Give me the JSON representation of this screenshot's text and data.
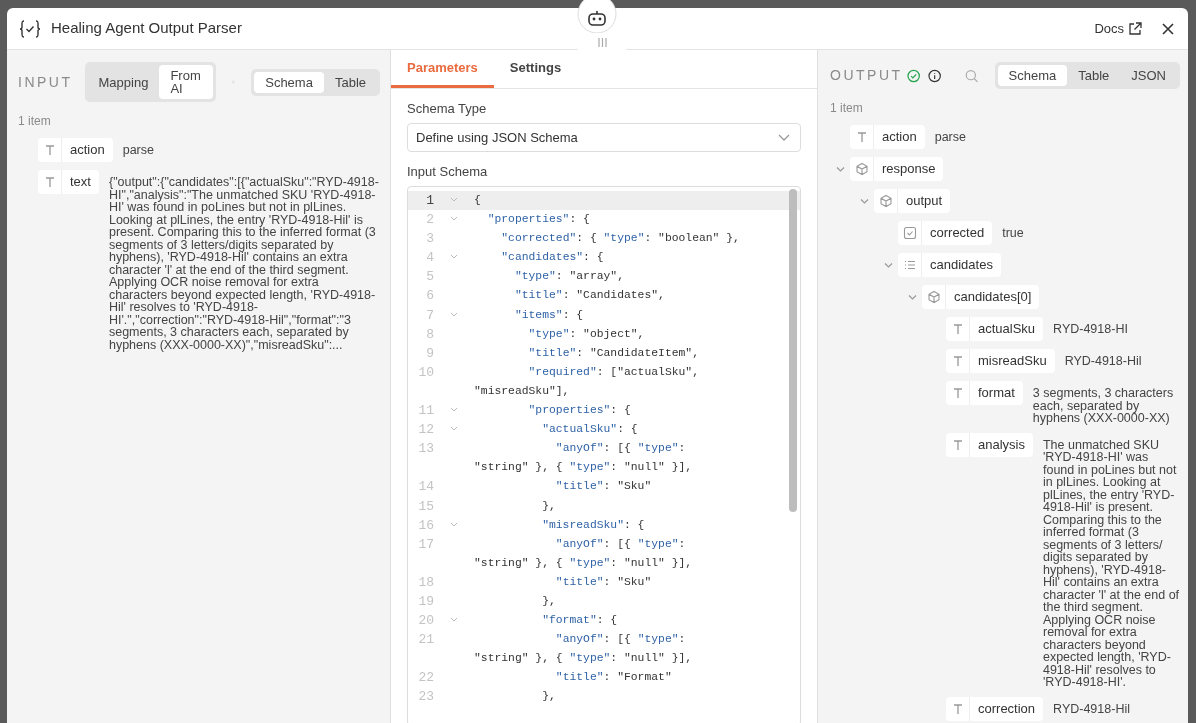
{
  "window": {
    "title": "Healing Agent Output Parser",
    "docs_link": "Docs"
  },
  "input": {
    "label": "INPUT",
    "count": "1 item",
    "mode_toggle": [
      {
        "label": "Mapping",
        "selected": false
      },
      {
        "label": "From AI",
        "selected": true
      }
    ],
    "view_toggle": [
      {
        "label": "Schema",
        "selected": true
      },
      {
        "label": "Table",
        "selected": false
      }
    ],
    "fields": [
      {
        "kind": "string",
        "key": "action",
        "value": "parse"
      },
      {
        "kind": "string",
        "key": "text",
        "value": "{\"output\":{\"candidates\":[{\"actualSku\":\"RYD-4918-HI\",\"analysis\":\"The unmatched SKU 'RYD-4918-HI' was found in poLines but not in plLines. Looking at plLines, the entry 'RYD-4918-Hil' is present. Comparing this to the inferred format (3 segments of 3 letters/digits separated by hyphens), 'RYD-4918-Hil' contains an extra character 'l' at the end of the third segment. Applying OCR noise removal for extra characters beyond expected length, 'RYD-4918-Hil' resolves to 'RYD-4918-HI'.\",\"correction\":\"RYD-4918-Hil\",\"format\":\"3 segments, 3 characters each, separated by hyphens (XXX-0000-XX)\",\"misreadSku\":..."
      }
    ]
  },
  "parameters": {
    "tabs": [
      {
        "label": "Parameters",
        "selected": true
      },
      {
        "label": "Settings",
        "selected": false
      }
    ],
    "schema_type": {
      "label": "Schema Type",
      "value": "Define using JSON Schema"
    },
    "input_schema": {
      "label": "Input Schema",
      "lines": [
        {
          "number": "1",
          "code": "{",
          "foldable": true,
          "active": true
        },
        {
          "number": "2",
          "code": "  \"properties\": {",
          "foldable": true,
          "active": false
        },
        {
          "number": "3",
          "code": "    \"corrected\": { \"type\": \"boolean\" },",
          "foldable": false,
          "active": false
        },
        {
          "number": "4",
          "code": "    \"candidates\": {",
          "foldable": true,
          "active": false
        },
        {
          "number": "5",
          "code": "      \"type\": \"array\",",
          "foldable": false,
          "active": false
        },
        {
          "number": "6",
          "code": "      \"title\": \"Candidates\",",
          "foldable": false,
          "active": false
        },
        {
          "number": "7",
          "code": "      \"items\": {",
          "foldable": true,
          "active": false
        },
        {
          "number": "8",
          "code": "        \"type\": \"object\",",
          "foldable": false,
          "active": false
        },
        {
          "number": "9",
          "code": "        \"title\": \"CandidateItem\",",
          "foldable": false,
          "active": false
        },
        {
          "number": "10",
          "code": "        \"required\": [\"actualSku\", \"misreadSku\"],",
          "foldable": false,
          "active": false
        },
        {
          "number": "11",
          "code": "        \"properties\": {",
          "foldable": true,
          "active": false
        },
        {
          "number": "12",
          "code": "          \"actualSku\": {",
          "foldable": true,
          "active": false
        },
        {
          "number": "13",
          "code": "            \"anyOf\": [{ \"type\": \"string\" }, { \"type\": \"null\" }],",
          "foldable": false,
          "active": false
        },
        {
          "number": "14",
          "code": "            \"title\": \"Sku\"",
          "foldable": false,
          "active": false
        },
        {
          "number": "15",
          "code": "          },",
          "foldable": false,
          "active": false
        },
        {
          "number": "16",
          "code": "          \"misreadSku\": {",
          "foldable": true,
          "active": false
        },
        {
          "number": "17",
          "code": "            \"anyOf\": [{ \"type\": \"string\" }, { \"type\": \"null\" }],",
          "foldable": false,
          "active": false
        },
        {
          "number": "18",
          "code": "            \"title\": \"Sku\"",
          "foldable": false,
          "active": false
        },
        {
          "number": "19",
          "code": "          },",
          "foldable": false,
          "active": false
        },
        {
          "number": "20",
          "code": "          \"format\": {",
          "foldable": true,
          "active": false
        },
        {
          "number": "21",
          "code": "            \"anyOf\": [{ \"type\": \"string\" }, { \"type\": \"null\" }],",
          "foldable": false,
          "active": false
        },
        {
          "number": "22",
          "code": "            \"title\": \"Format\"",
          "foldable": false,
          "active": false
        },
        {
          "number": "23",
          "code": "          },",
          "foldable": false,
          "active": false
        }
      ]
    }
  },
  "output": {
    "label": "OUTPUT",
    "count": "1 item",
    "view_toggle": [
      {
        "label": "Schema",
        "selected": true
      },
      {
        "label": "Table",
        "selected": false
      },
      {
        "label": "JSON",
        "selected": false
      }
    ],
    "fields": [
      {
        "kind": "string",
        "key": "action",
        "value": "parse"
      },
      {
        "kind": "object",
        "key": "response",
        "expanded": true,
        "children": [
          {
            "kind": "object",
            "key": "output",
            "expanded": true,
            "children": [
              {
                "kind": "boolean",
                "key": "corrected",
                "value": "true"
              },
              {
                "kind": "array",
                "key": "candidates",
                "expanded": true,
                "children": [
                  {
                    "kind": "object",
                    "key": "candidates[0]",
                    "expanded": true,
                    "children": [
                      {
                        "kind": "string",
                        "key": "actualSku",
                        "value": "RYD-4918-HI"
                      },
                      {
                        "kind": "string",
                        "key": "misreadSku",
                        "value": "RYD-4918-Hil"
                      },
                      {
                        "kind": "string",
                        "key": "format",
                        "value": "3 segments, 3 characters each, separated by hyphens (XXX-0000-XX)"
                      },
                      {
                        "kind": "string",
                        "key": "analysis",
                        "value": "The unmatched SKU 'RYD-4918-HI' was found in poLines but not in plLines. Looking at plLines, the entry 'RYD-4918-Hil' is present. Comparing this to the inferred format (3 segments of 3 letters/ digits separated by hyphens), 'RYD-4918-Hil' contains an extra character 'l' at the end of the third segment. Applying OCR noise removal for extra characters beyond expected length, 'RYD-4918-Hil' resolves to 'RYD-4918-HI'."
                      },
                      {
                        "kind": "string",
                        "key": "correction",
                        "value": "RYD-4918-Hil"
                      }
                    ]
                  }
                ]
              }
            ]
          }
        ]
      }
    ]
  }
}
